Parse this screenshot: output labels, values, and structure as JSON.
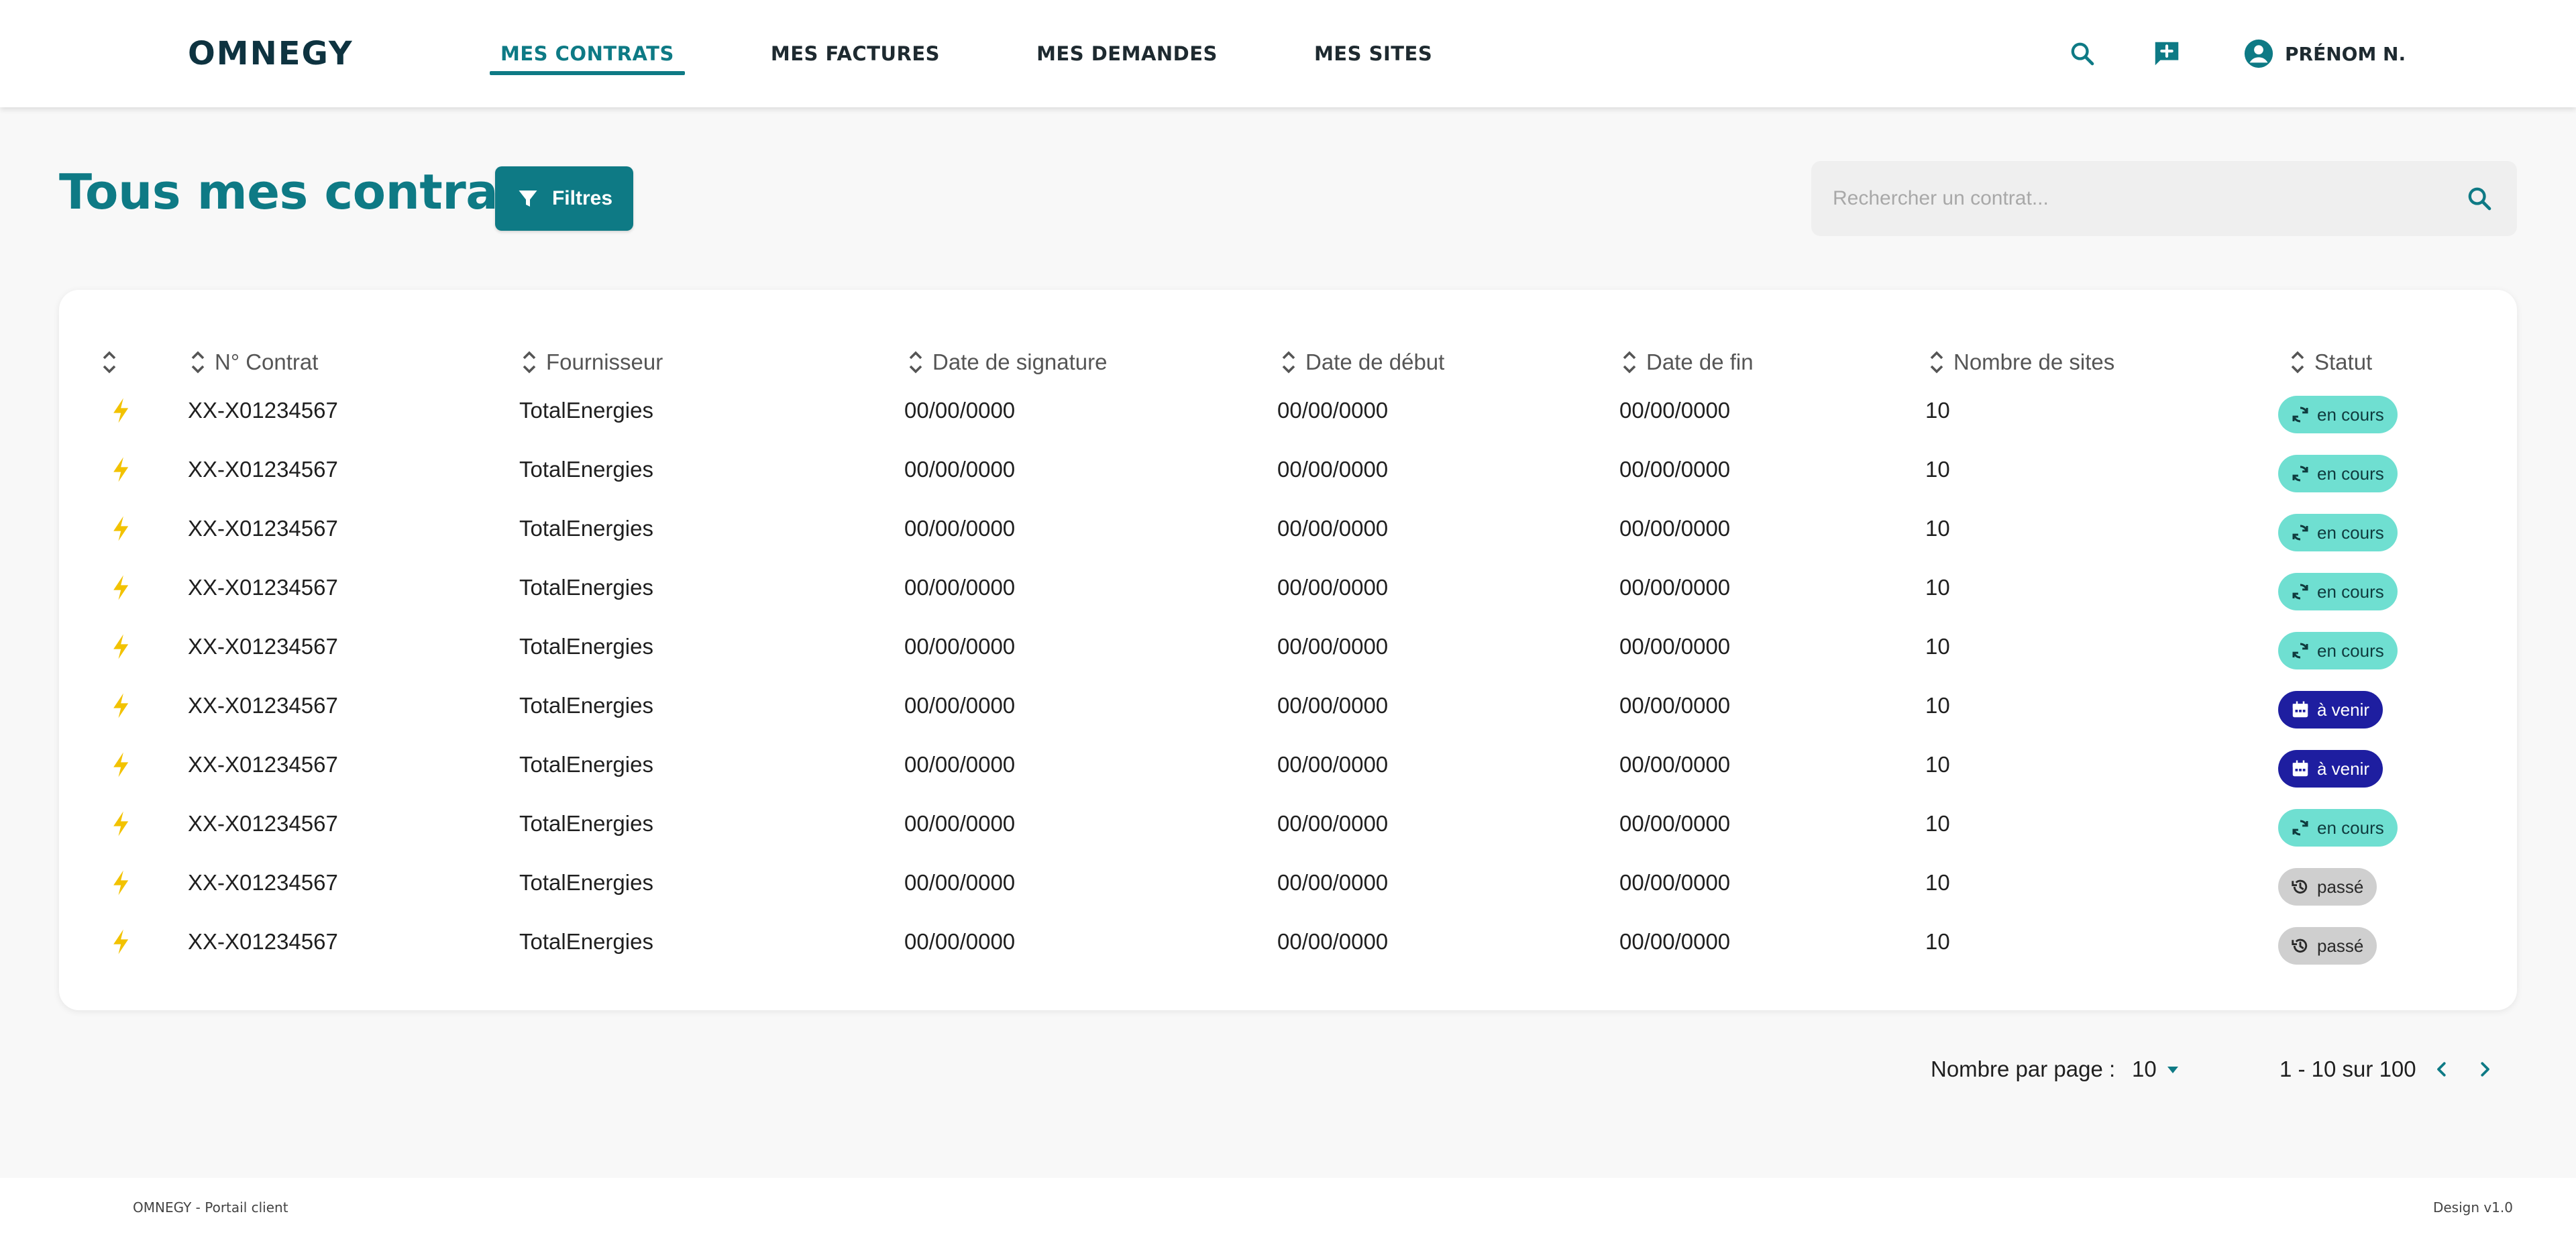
{
  "header": {
    "logo_text": "OMNEGY",
    "nav": [
      {
        "label": "MES CONTRATS",
        "active": true
      },
      {
        "label": "MES FACTURES",
        "active": false
      },
      {
        "label": "MES DEMANDES",
        "active": false
      },
      {
        "label": "MES SITES",
        "active": false
      }
    ],
    "icons": [
      "search-icon",
      "add-comment-icon",
      "account-circle-icon"
    ],
    "user_name": "PRÉNOM N."
  },
  "page": {
    "title": "Tous mes contrats",
    "filter_label": "Filtres",
    "search_placeholder": "Rechercher un contrat..."
  },
  "table": {
    "columns": [
      "N° Contrat",
      "Fournisseur",
      "Date de signature",
      "Date de début",
      "Date de fin",
      "Nombre de sites",
      "Statut"
    ],
    "rows": [
      {
        "contract": "XX-X01234567",
        "supplier": "TotalEnergies",
        "signed": "00/00/0000",
        "start": "00/00/0000",
        "end": "00/00/0000",
        "sites": "10",
        "status": "en cours",
        "status_type": "encours"
      },
      {
        "contract": "XX-X01234567",
        "supplier": "TotalEnergies",
        "signed": "00/00/0000",
        "start": "00/00/0000",
        "end": "00/00/0000",
        "sites": "10",
        "status": "en cours",
        "status_type": "encours"
      },
      {
        "contract": "XX-X01234567",
        "supplier": "TotalEnergies",
        "signed": "00/00/0000",
        "start": "00/00/0000",
        "end": "00/00/0000",
        "sites": "10",
        "status": "en cours",
        "status_type": "encours"
      },
      {
        "contract": "XX-X01234567",
        "supplier": "TotalEnergies",
        "signed": "00/00/0000",
        "start": "00/00/0000",
        "end": "00/00/0000",
        "sites": "10",
        "status": "en cours",
        "status_type": "encours"
      },
      {
        "contract": "XX-X01234567",
        "supplier": "TotalEnergies",
        "signed": "00/00/0000",
        "start": "00/00/0000",
        "end": "00/00/0000",
        "sites": "10",
        "status": "en cours",
        "status_type": "encours"
      },
      {
        "contract": "XX-X01234567",
        "supplier": "TotalEnergies",
        "signed": "00/00/0000",
        "start": "00/00/0000",
        "end": "00/00/0000",
        "sites": "10",
        "status": "à venir",
        "status_type": "avenir"
      },
      {
        "contract": "XX-X01234567",
        "supplier": "TotalEnergies",
        "signed": "00/00/0000",
        "start": "00/00/0000",
        "end": "00/00/0000",
        "sites": "10",
        "status": "à venir",
        "status_type": "avenir"
      },
      {
        "contract": "XX-X01234567",
        "supplier": "TotalEnergies",
        "signed": "00/00/0000",
        "start": "00/00/0000",
        "end": "00/00/0000",
        "sites": "10",
        "status": "en cours",
        "status_type": "encours"
      },
      {
        "contract": "XX-X01234567",
        "supplier": "TotalEnergies",
        "signed": "00/00/0000",
        "start": "00/00/0000",
        "end": "00/00/0000",
        "sites": "10",
        "status": "passé",
        "status_type": "passe"
      },
      {
        "contract": "XX-X01234567",
        "supplier": "TotalEnergies",
        "signed": "00/00/0000",
        "start": "00/00/0000",
        "end": "00/00/0000",
        "sites": "10",
        "status": "passé",
        "status_type": "passe"
      }
    ]
  },
  "pagination": {
    "per_page_label": "Nombre par page :",
    "per_page_value": "10",
    "range_text": "1 - 10 sur 100"
  },
  "footer": {
    "left": "OMNEGY - Portail client",
    "right": "Design v1.0"
  },
  "colors": {
    "accent": "#0e7a85",
    "encours": "#6fdfd1",
    "avenir": "#1e1ea0",
    "passe": "#cfcfcf",
    "bolt": "#f2c200"
  }
}
